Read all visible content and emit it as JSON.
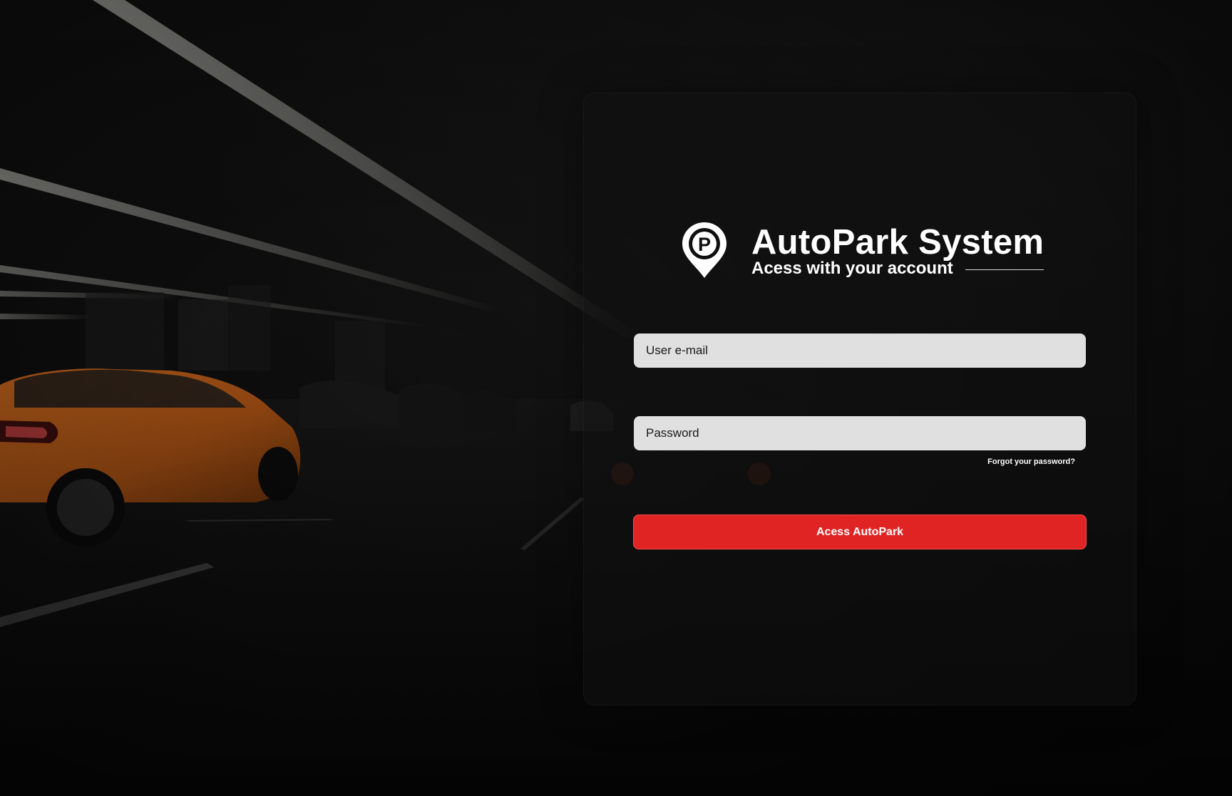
{
  "brand": {
    "logo_icon": "parking-pin-icon",
    "title": "AutoPark System",
    "subtitle": "Acess with your account"
  },
  "form": {
    "email_placeholder": "User e-mail",
    "password_placeholder": "Password",
    "forgot_password_label": "Forgot your password?",
    "submit_label": "Acess AutoPark"
  },
  "colors": {
    "accent": "#e02424",
    "input_background": "#e1e0e1",
    "page_background": "#0b0b0b",
    "text_on_dark": "#ffffff"
  },
  "background": {
    "scene": "dark underground parking garage with orange car"
  }
}
